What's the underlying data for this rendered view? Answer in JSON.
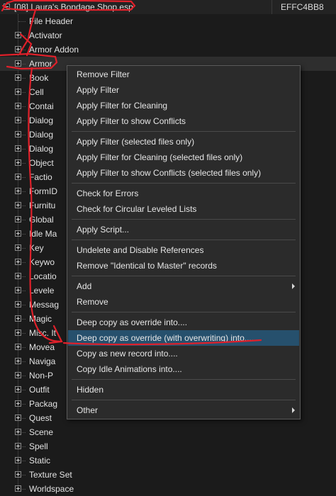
{
  "tree": {
    "root": {
      "label": "[08] Laura's Bondage Shop.esp",
      "form_id": "EFFC4BB8"
    },
    "items": [
      {
        "label": "File Header",
        "expander": "none"
      },
      {
        "label": "Activator",
        "expander": "plus"
      },
      {
        "label": "Armor Addon",
        "expander": "plus"
      },
      {
        "label": "Armor",
        "expander": "plus"
      },
      {
        "label": "Book",
        "expander": "plus"
      },
      {
        "label": "Cell",
        "expander": "plus"
      },
      {
        "label": "Contai",
        "expander": "plus"
      },
      {
        "label": "Dialog",
        "expander": "plus"
      },
      {
        "label": "Dialog",
        "expander": "plus"
      },
      {
        "label": "Dialog",
        "expander": "plus"
      },
      {
        "label": "Object",
        "expander": "plus"
      },
      {
        "label": "Factio",
        "expander": "plus"
      },
      {
        "label": "FormID",
        "expander": "plus"
      },
      {
        "label": "Furnitu",
        "expander": "plus"
      },
      {
        "label": "Global",
        "expander": "plus"
      },
      {
        "label": "Idle Ma",
        "expander": "plus"
      },
      {
        "label": "Key",
        "expander": "plus"
      },
      {
        "label": "Keywo",
        "expander": "plus"
      },
      {
        "label": "Locatio",
        "expander": "plus"
      },
      {
        "label": "Levele",
        "expander": "plus"
      },
      {
        "label": "Messag",
        "expander": "plus"
      },
      {
        "label": "Magic",
        "expander": "plus"
      },
      {
        "label": "Misc. It",
        "expander": "plus"
      },
      {
        "label": "Movea",
        "expander": "plus"
      },
      {
        "label": "Naviga",
        "expander": "plus"
      },
      {
        "label": "Non-P",
        "expander": "plus"
      },
      {
        "label": "Outfit",
        "expander": "plus"
      },
      {
        "label": "Packag",
        "expander": "plus"
      },
      {
        "label": "Quest",
        "expander": "plus"
      },
      {
        "label": "Scene",
        "expander": "plus"
      },
      {
        "label": "Spell",
        "expander": "plus"
      },
      {
        "label": "Static",
        "expander": "plus"
      },
      {
        "label": "Texture Set",
        "expander": "plus"
      },
      {
        "label": "Worldspace",
        "expander": "plus"
      }
    ]
  },
  "context_menu": {
    "items": [
      {
        "label": "Remove Filter"
      },
      {
        "label": "Apply Filter"
      },
      {
        "label": "Apply Filter for Cleaning"
      },
      {
        "label": "Apply Filter to show Conflicts"
      },
      {
        "separator": true
      },
      {
        "label": "Apply Filter (selected files only)"
      },
      {
        "label": "Apply Filter for Cleaning (selected files only)"
      },
      {
        "label": "Apply Filter to show Conflicts (selected files only)"
      },
      {
        "separator": true
      },
      {
        "label": "Check for Errors"
      },
      {
        "label": "Check for Circular Leveled Lists"
      },
      {
        "separator": true
      },
      {
        "label": "Apply Script..."
      },
      {
        "separator": true
      },
      {
        "label": "Undelete and Disable References"
      },
      {
        "label": "Remove \"Identical to Master\" records"
      },
      {
        "separator": true
      },
      {
        "label": "Add",
        "submenu": true
      },
      {
        "label": "Remove"
      },
      {
        "separator": true
      },
      {
        "label": "Deep copy as override into...."
      },
      {
        "label": "Deep copy as override (with overwriting) into....",
        "highlighted": true
      },
      {
        "label": "Copy as new record into...."
      },
      {
        "label": "Copy Idle Animations into...."
      },
      {
        "separator": true
      },
      {
        "label": "Hidden"
      },
      {
        "separator": true
      },
      {
        "label": "Other",
        "submenu": true
      }
    ]
  },
  "colors": {
    "background": "#1b1b1b",
    "menu_background": "#2b2b2b",
    "menu_highlight": "#26506d",
    "annotation": "#e0202a"
  }
}
